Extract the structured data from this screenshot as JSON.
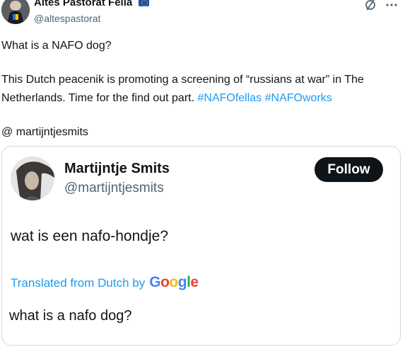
{
  "author": {
    "name": "Altes Pastorat Fella",
    "handle": "@altespastorat",
    "flag_icon": "eu-flag-icon"
  },
  "actions": {
    "grok_icon": "slashed-circle-icon",
    "more_icon": "ellipsis-icon"
  },
  "tweet": {
    "line1": "What is a NAFO dog?",
    "line2_text": "This Dutch peacenik is promoting a screening of “russians at war” in The Netherlands. Time for the find out part.",
    "hashtags": [
      "#NAFOfellas",
      "#NAFOworks"
    ],
    "line3": "@ martijntjesmits"
  },
  "quoted_card": {
    "name": "Martijntje Smits",
    "handle": "@martijntjesmits",
    "follow_label": "Follow",
    "original_text": "wat is een nafo-hondje?",
    "translated_prefix": "Translated from Dutch by",
    "translator_logo": "Google",
    "translated_text": "what is a nafo dog?"
  },
  "colors": {
    "link": "#1d9bf0",
    "text": "#0f1419",
    "secondary": "#536471",
    "follow_bg": "#0f1419",
    "border": "#cfd9de",
    "google_blue": "#4285f4",
    "google_red": "#ea4335",
    "google_yellow": "#fbbc05",
    "google_green": "#34a853"
  }
}
